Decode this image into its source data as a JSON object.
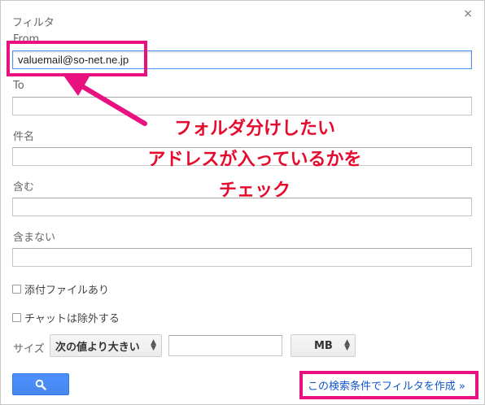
{
  "dialog": {
    "title": "フィルタ",
    "close_glyph": "×"
  },
  "fields": {
    "from": {
      "label": "From",
      "value": "valuemail@so-net.ne.jp"
    },
    "to": {
      "label": "To",
      "value": ""
    },
    "subject": {
      "label": "件名",
      "value": ""
    },
    "has_words": {
      "label": "含む",
      "value": ""
    },
    "doesnt_have": {
      "label": "含まない",
      "value": ""
    }
  },
  "options": {
    "has_attachment": "添付ファイルあり",
    "exclude_chats": "チャットは除外する"
  },
  "size": {
    "label": "サイズ",
    "comparator": "次の値より大きい",
    "value": "",
    "unit": "MB"
  },
  "actions": {
    "search_icon": "search-icon",
    "create_filter_link": "この検索条件でフィルタを作成 »"
  },
  "annotation": {
    "line1": "フォルダ分けしたい",
    "line2": "アドレスが入っているかを",
    "line3": "チェック",
    "color": "#e60a2d",
    "box_color": "#e8117f"
  }
}
